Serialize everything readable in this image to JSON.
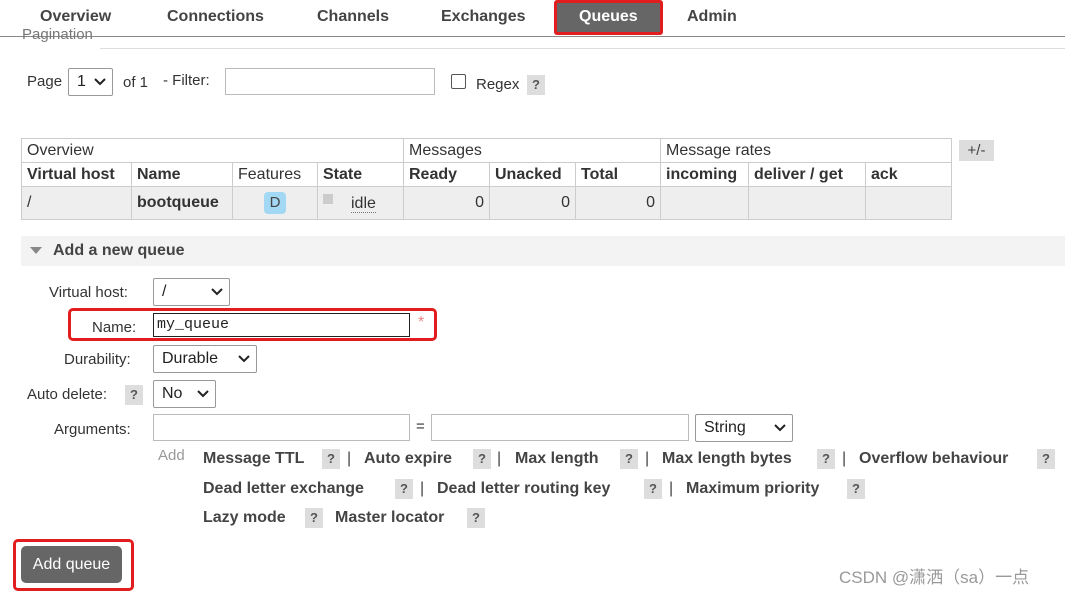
{
  "nav": {
    "tabs": [
      {
        "label": "Overview"
      },
      {
        "label": "Connections"
      },
      {
        "label": "Channels"
      },
      {
        "label": "Exchanges"
      },
      {
        "label": "Queues",
        "active": true
      },
      {
        "label": "Admin"
      }
    ]
  },
  "pagination": {
    "section_label": "Pagination",
    "page_label": "Page",
    "page_value": "1",
    "of_label": "of 1",
    "filter_label": "- Filter:",
    "filter_value": "",
    "regex_label": "Regex",
    "help": "?"
  },
  "table": {
    "groups": [
      "Overview",
      "Messages",
      "Message rates"
    ],
    "columns": [
      "Virtual host",
      "Name",
      "Features",
      "State",
      "Ready",
      "Unacked",
      "Total",
      "incoming",
      "deliver / get",
      "ack"
    ],
    "rows": [
      {
        "vhost": "/",
        "name": "bootqueue",
        "feature": "D",
        "state": "idle",
        "ready": "0",
        "unacked": "0",
        "total": "0",
        "incoming": "",
        "deliver_get": "",
        "ack": ""
      }
    ],
    "toggle_label": "+/-"
  },
  "add_queue": {
    "title": "Add a new queue",
    "vhost_label": "Virtual host:",
    "vhost_value": "/",
    "name_label": "Name:",
    "name_value": "my_queue",
    "required_mark": "*",
    "durability_label": "Durability:",
    "durability_value": "Durable",
    "auto_delete_label": "Auto delete:",
    "auto_delete_value": "No",
    "arguments_label": "Arguments:",
    "equals": "=",
    "arg_type": "String",
    "add_label": "Add",
    "arg_links": [
      "Message TTL",
      "Auto expire",
      "Max length",
      "Max length bytes",
      "Overflow behaviour",
      "Dead letter exchange",
      "Dead letter routing key",
      "Maximum priority",
      "Lazy mode",
      "Master locator"
    ],
    "separator": "|",
    "submit_label": "Add queue"
  },
  "watermark": "CSDN @潇洒（sa）一点",
  "colors": {
    "highlight": "#e21d1d",
    "active_tab": "#666666",
    "badge": "#a3d8f5"
  }
}
